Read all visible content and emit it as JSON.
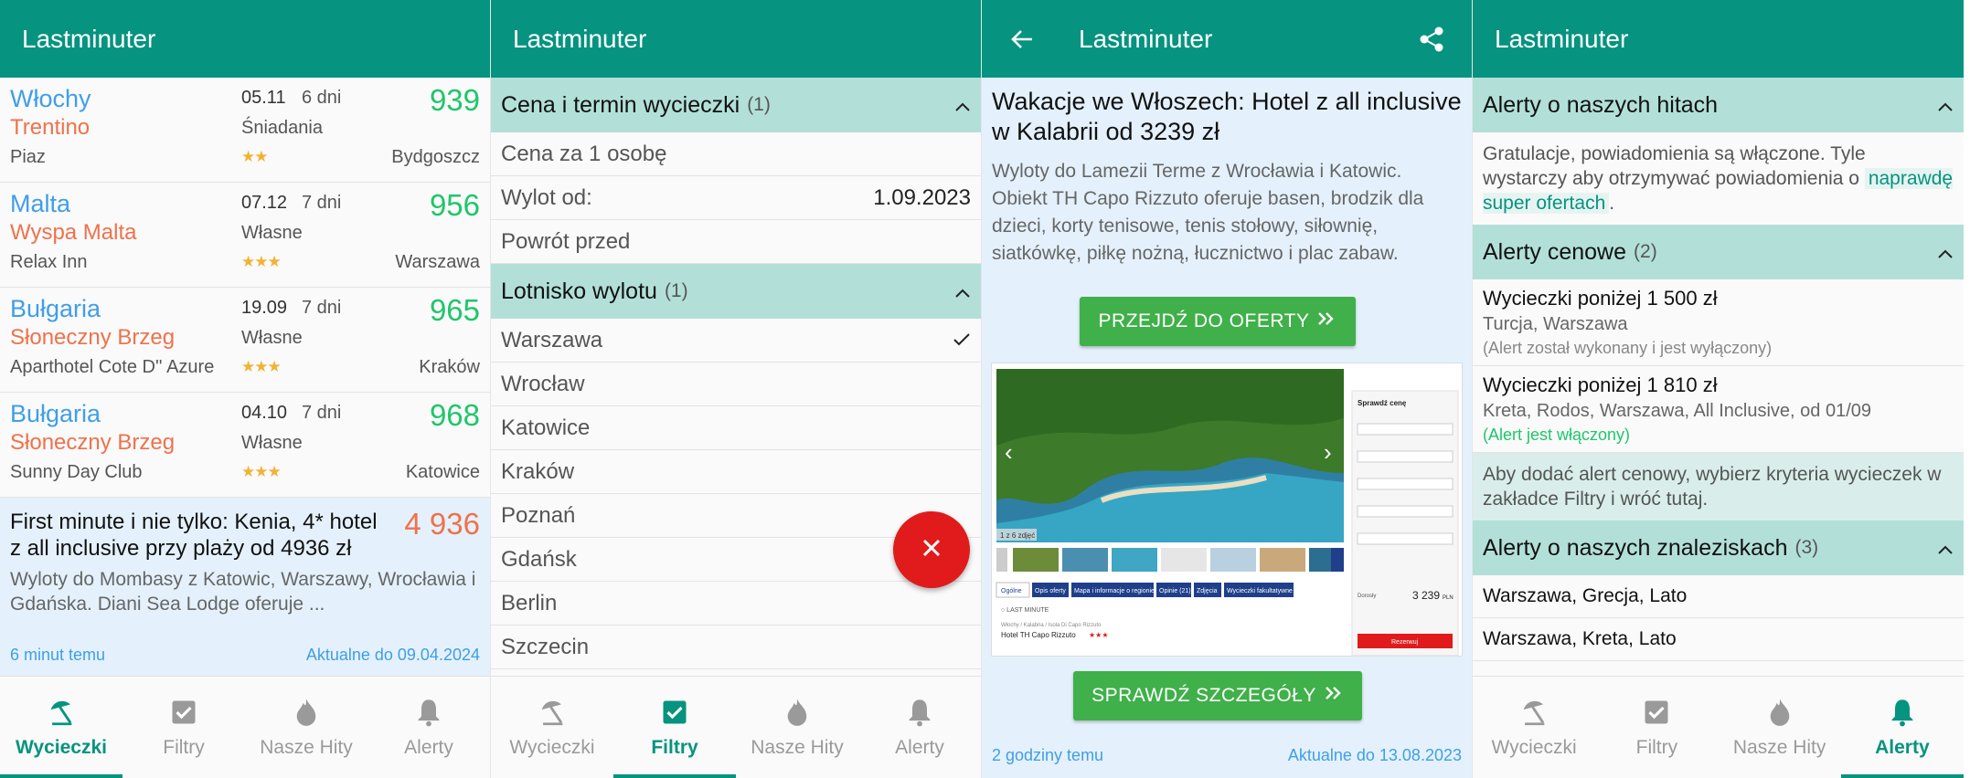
{
  "app": {
    "title": "Lastminuter"
  },
  "colors": {
    "primary": "#069380",
    "country": "#3f9ee8",
    "region": "#f0714a",
    "price": "#1fc66b",
    "fab": "#e11b1b",
    "button": "#40b04a"
  },
  "nav": [
    {
      "label": "Wycieczki",
      "icon": "beach-umbrella-icon"
    },
    {
      "label": "Filtry",
      "icon": "checkbox-icon"
    },
    {
      "label": "Nasze Hity",
      "icon": "flame-icon"
    },
    {
      "label": "Alerty",
      "icon": "bell-icon"
    }
  ],
  "offers": [
    {
      "country": "Włochy",
      "region": "Trentino",
      "hotel": "Piaz",
      "date": "05.11",
      "days": "6 dni",
      "board": "Śniadania",
      "stars": 2,
      "price": "939",
      "city": "Bydgoszcz"
    },
    {
      "country": "Malta",
      "region": "Wyspa Malta",
      "hotel": "Relax Inn",
      "date": "07.12",
      "days": "7 dni",
      "board": "Własne",
      "stars": 3,
      "price": "956",
      "city": "Warszawa"
    },
    {
      "country": "Bułgaria",
      "region": "Słoneczny Brzeg",
      "hotel": "Aparthotel Cote D'' Azure",
      "date": "19.09",
      "days": "7 dni",
      "board": "Własne",
      "stars": 3,
      "price": "965",
      "city": "Kraków"
    },
    {
      "country": "Bułgaria",
      "region": "Słoneczny Brzeg",
      "hotel": "Sunny Day Club",
      "date": "04.10",
      "days": "7 dni",
      "board": "Własne",
      "stars": 3,
      "price": "968",
      "city": "Katowice"
    }
  ],
  "promo": {
    "title": "First minute i nie tylko: Kenia, 4* hotel z all inclusive przy plaży od 4936 zł",
    "price": "4 936",
    "desc": "Wyloty do Mombasy z Katowic, Warszawy, Wrocławia i Gdańska. Diani Sea Lodge oferuje ...",
    "ago": "6 minut temu",
    "valid": "Aktualne do 09.04.2024"
  },
  "filters": {
    "section1": {
      "title": "Cena i termin wycieczki",
      "count": "(1)"
    },
    "price_row": "Cena za 1 osobę",
    "departure_label": "Wylot od:",
    "departure_value": "1.09.2023",
    "return_label": "Powrót przed",
    "section2": {
      "title": "Lotnisko wylotu",
      "count": "(1)"
    },
    "airports": [
      "Warszawa",
      "Wrocław",
      "Katowice",
      "Kraków",
      "Poznań",
      "Gdańsk",
      "Berlin",
      "Szczecin"
    ],
    "selected_airport": 0
  },
  "detail": {
    "title": "Wakacje we Włoszech: Hotel z all inclusive w Kalabrii od 3239 zł",
    "desc": "Wyloty do Lamezii Terme z Wrocławia i Katowic. Obiekt TH Capo Rizzuto oferuje basen, brodzik dla dzieci, korty tenisowe, tenis stołowy, siłownię, siatkówkę, piłkę nożną, łucznictwo i plac zabaw.",
    "btn_offer": "PRZEJDŹ DO OFERTY",
    "btn_details": "SPRAWDŹ SZCZEGÓŁY",
    "ago": "2 godziny temu",
    "valid": "Aktualne do 13.08.2023",
    "shot": {
      "check": "Sprawdź cenę",
      "tabs": [
        "Ogólne",
        "Opis oferty",
        "Mapa i informacje o regionie",
        "Opinie (21)",
        "Zdjęcia",
        "Wycieczki fakultatywne"
      ],
      "last": "LAST MINUTE",
      "crumb": "Włochy / Kalabria / Isola Di Capo Rizzuto",
      "hotel": "Hotel TH Capo Rizzuto",
      "price": "3 239",
      "currency": "PLN",
      "reserve": "Rezerwuj",
      "counter": "1 z 6 zdjęć"
    }
  },
  "alerts": {
    "hits": {
      "title": "Alerty o naszych hitach",
      "text_a": "Gratulacje, powiadomienia są włączone. Tyle wystarczy aby otrzymywać powiadomienia o ",
      "chip": "naprawdę super ofertach",
      "text_b": "."
    },
    "price": {
      "title": "Alerty cenowe",
      "count": "(2)"
    },
    "price_items": [
      {
        "title": "Wycieczki poniżej 1 500 zł",
        "sub": "Turcja, Warszawa",
        "status": "(Alert został wykonany i jest wyłączony)",
        "on": false
      },
      {
        "title": "Wycieczki poniżej 1 810 zł",
        "sub": "Kreta, Rodos, Warszawa, All Inclusive, od 01/09",
        "status": "(Alert jest włączony)",
        "on": true
      }
    ],
    "hint": "Aby dodać alert cenowy, wybierz kryteria wycieczek w zakładce Filtry i wróć tutaj.",
    "finds": {
      "title": "Alerty o naszych znaleziskach",
      "count": "(3)"
    },
    "find_items": [
      "Warszawa, Grecja, Lato",
      "Warszawa, Kreta, Lato"
    ]
  }
}
